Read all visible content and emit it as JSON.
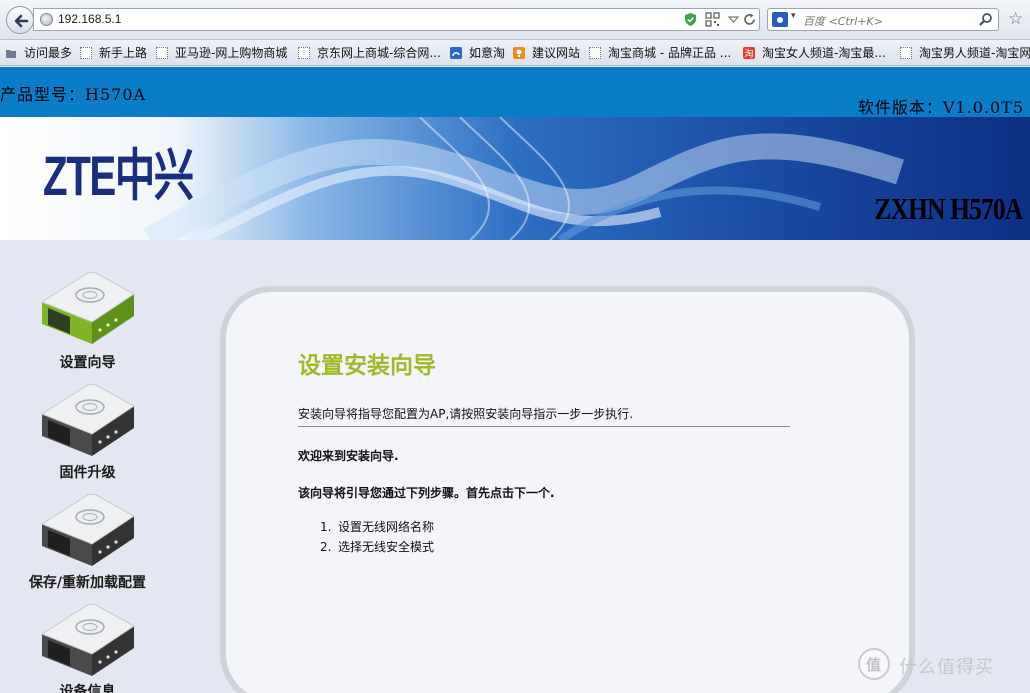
{
  "browser": {
    "url": "192.168.5.1",
    "search_placeholder": "百度 <Ctrl+K>",
    "bookmarks": [
      {
        "label": "访问最多",
        "icon": "folder-icon"
      },
      {
        "label": "新手上路",
        "icon": "page-icon"
      },
      {
        "label": "亚马逊-网上购物商城",
        "icon": "page-icon"
      },
      {
        "label": "京东网上商城-综合网...",
        "icon": "page-icon"
      },
      {
        "label": "如意淘",
        "icon": "ruyitao-icon"
      },
      {
        "label": "建议网站",
        "icon": "suggest-icon"
      },
      {
        "label": "淘宝商城 - 品牌正品 ...",
        "icon": "page-icon"
      },
      {
        "label": "淘宝女人频道-淘宝最...",
        "icon": "taobao-icon"
      },
      {
        "label": "淘宝男人频道-淘宝网",
        "icon": "page-icon"
      }
    ]
  },
  "page": {
    "product_model": "产品型号：H570A",
    "software_version": "软件版本：V1.0.0T5",
    "banner": {
      "logo": "ZTE中兴",
      "model": "ZXHN H570A"
    },
    "nav": [
      {
        "label": "设置向导",
        "active": true
      },
      {
        "label": "固件升级",
        "active": false
      },
      {
        "label": "保存/重新加载配置",
        "active": false
      },
      {
        "label": "设备信息",
        "active": false
      }
    ],
    "wizard": {
      "title": "设置安装向导",
      "intro": "安装向导将指导您配置为AP,请按照安装向导指示一步一步执行.",
      "welcome": "欢迎来到安装向导.",
      "steps_intro": "该向导将引导您通过下列步骤。首先点击下一个.",
      "steps": [
        "设置无线网络名称",
        "选择无线安全模式"
      ]
    },
    "watermark": "什么值得买"
  },
  "colors": {
    "header_blue": "#0a7dc9",
    "wizard_title": "#9bbb28",
    "active_device_green": "#7fb526",
    "inactive_device_dark": "#4a4a4a"
  }
}
